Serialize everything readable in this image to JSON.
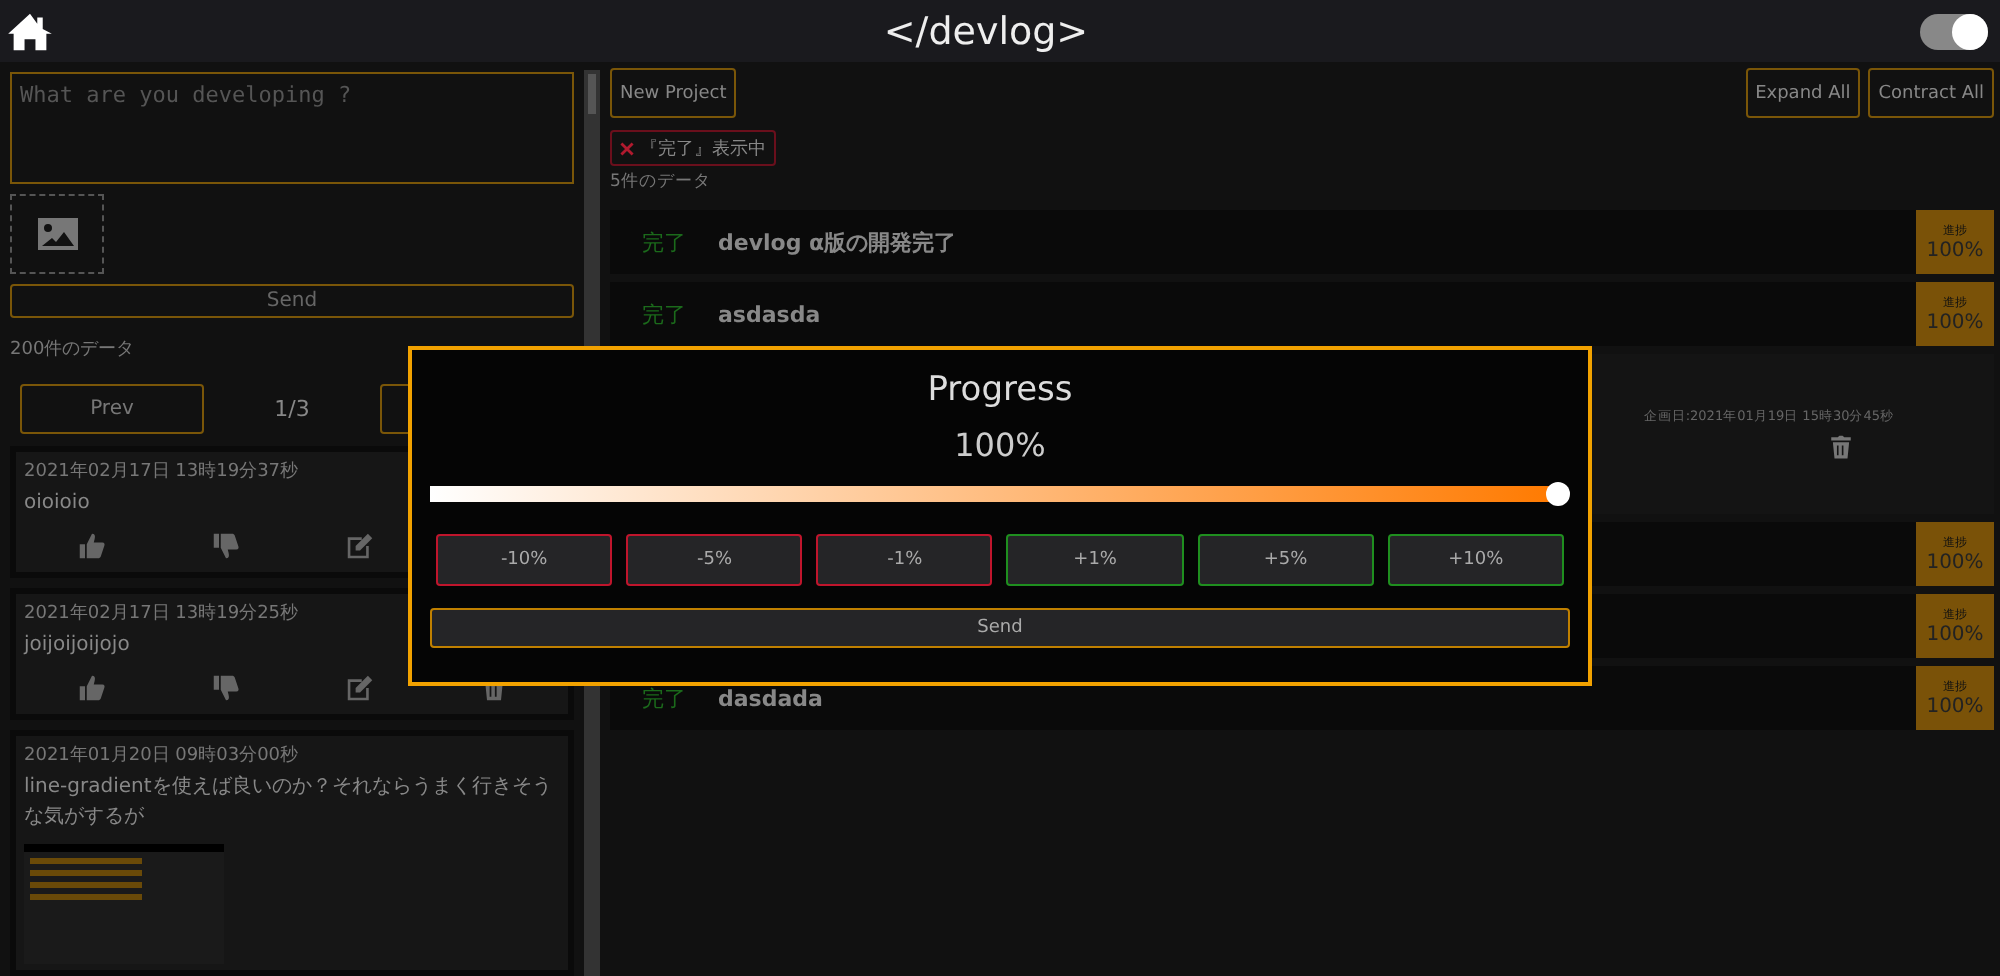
{
  "header": {
    "title": "</devlog>",
    "theme_toggle": {
      "on": true
    }
  },
  "composer": {
    "placeholder": "What are you developing ?",
    "send": "Send"
  },
  "posts_count": "200件のデータ",
  "pager": {
    "prev": "Prev",
    "page": "1/3"
  },
  "posts": [
    {
      "kind": "text",
      "date": "2021年02月17日 13時19分37秒",
      "text": "oioioio"
    },
    {
      "kind": "text",
      "date": "2021年02月17日 13時19分25秒",
      "text": "joijoijoijojo"
    },
    {
      "kind": "image",
      "date": "2021年01月20日 09時03分00秒",
      "text": "line-gradientを使えば良いのか？それならうまく行きそうな気がするが"
    }
  ],
  "toolbar": {
    "new_project": "New Project",
    "expand_all": "Expand All",
    "contract_all": "Contract All"
  },
  "filter_chip": "『完了』表示中",
  "projects_count": "5件のデータ",
  "projects": [
    {
      "kind": "project",
      "status": "完了",
      "title": "devlog α版の開発完了",
      "progress_label": "進捗",
      "progress": "100%"
    },
    {
      "kind": "project",
      "status": "完了",
      "title": "asdasda",
      "progress_label": "進捗",
      "progress": "100%"
    },
    {
      "kind": "detail",
      "planned_date": "企画日:2021年01月19日 15時30分45秒"
    },
    {
      "kind": "project",
      "progress_label": "進捗",
      "progress": "100%"
    },
    {
      "kind": "project",
      "progress_label": "進捗",
      "progress": "100%"
    },
    {
      "kind": "project",
      "status": "完了",
      "title": "dasdada",
      "progress_label": "進捗",
      "progress": "100%"
    }
  ],
  "progress_dialog": {
    "title": "Progress",
    "value": "100%",
    "level": 1.0,
    "steps": [
      {
        "label": "-10%",
        "kind": "decrease"
      },
      {
        "label": "-5%",
        "kind": "decrease"
      },
      {
        "label": "-1%",
        "kind": "decrease"
      },
      {
        "label": "+1%",
        "kind": "increase"
      },
      {
        "label": "+5%",
        "kind": "increase"
      },
      {
        "label": "+10%",
        "kind": "increase"
      }
    ],
    "send": "Send"
  }
}
